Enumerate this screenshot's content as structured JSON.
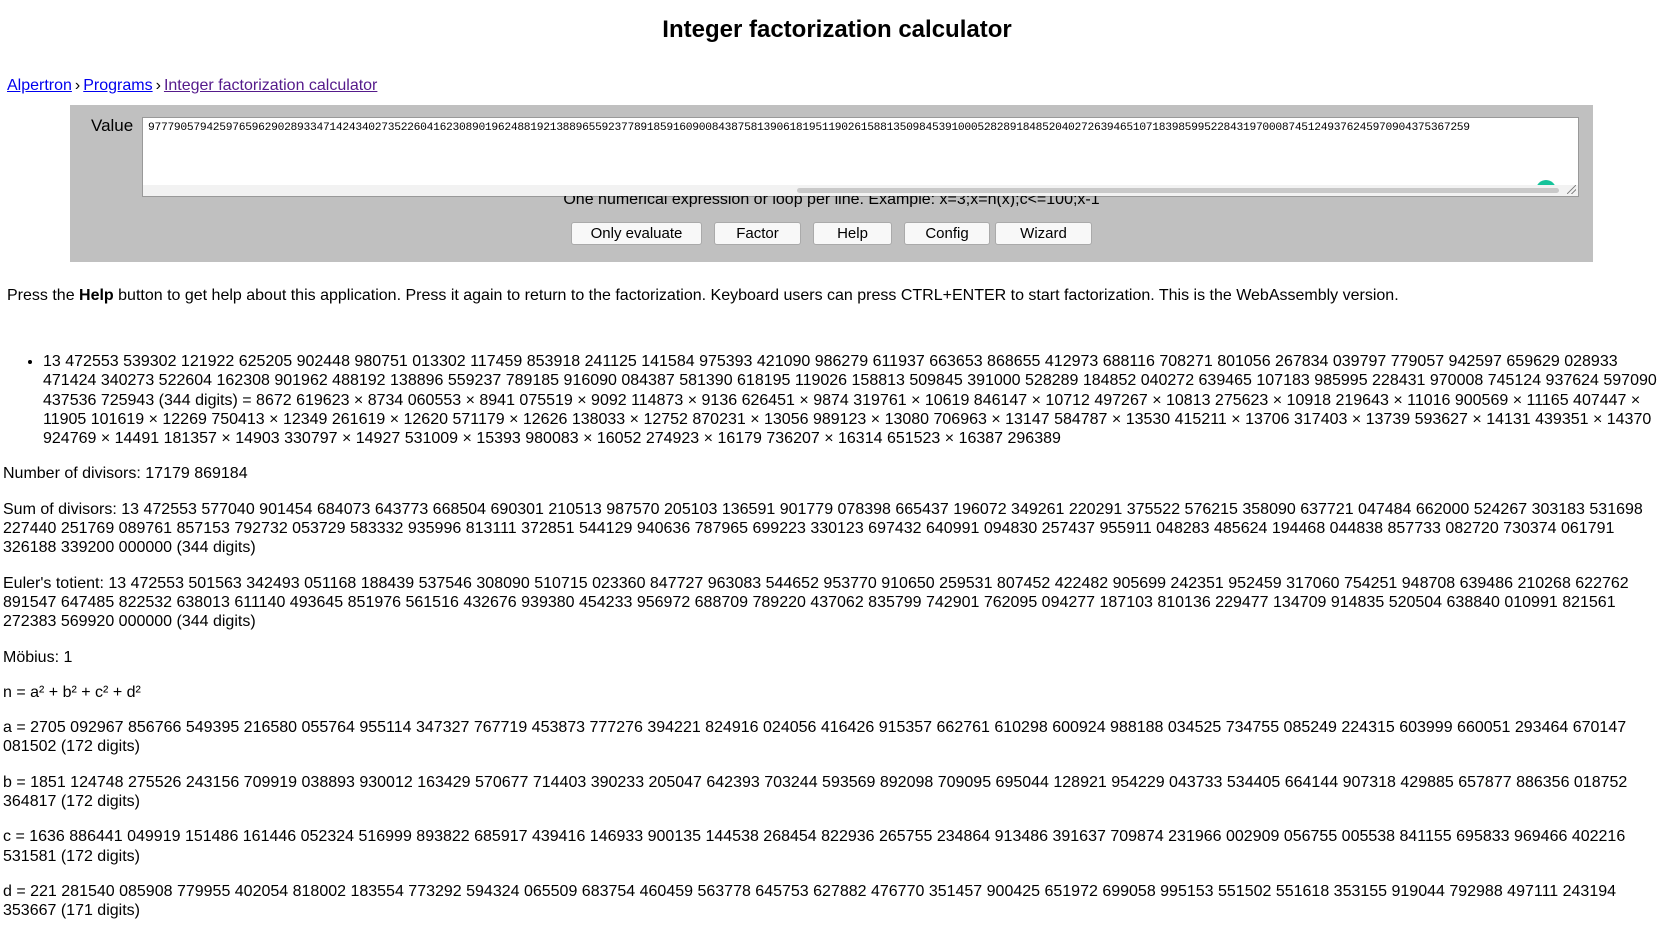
{
  "title": "Integer factorization calculator",
  "breadcrumb": {
    "items": [
      "Alpertron",
      "Programs",
      "Integer factorization calculator"
    ],
    "separator": "›"
  },
  "form": {
    "value_label": "Value",
    "value_text": "977790579425976596290289334714243402735226041623089019624881921388965592377891859160900843875813906181951190261588135098453910005282891848520402726394651071839859952284319700087451249376245970904375367259",
    "hint": "One numerical expression or loop per line. Example: x=3;x=n(x);c<=100;x-1",
    "buttons": {
      "only_evaluate": "Only evaluate",
      "factor": "Factor",
      "help": "Help",
      "config": "Config",
      "wizard": "Wizard"
    }
  },
  "help_line": {
    "pre": "Press the ",
    "bold": "Help",
    "post": " button to get help about this application. Press it again to return to the factorization. Keyboard users can press CTRL+ENTER to start factorization. This is the WebAssembly version."
  },
  "results": {
    "factorization": "13 472553 539302 121922 625205 902448 980751 013302 117459 853918 241125 141584 975393 421090 986279 611937 663653 868655 412973 688116 708271 801056 267834 039797 779057 942597 659629 028933 471424 340273 522604 162308 901962 488192 138896 559237 789185 916090 084387 581390 618195 119026 158813 509845 391000 528289 184852 040272 639465 107183 985995 228431 970008 745124 937624 597090 437536 725943 (344 digits) = 8672 619623 × 8734 060553 × 8941 075519 × 9092 114873 × 9136 626451 × 9874 319761 × 10619 846147 × 10712 497267 × 10813 275623 × 10918 219643 × 11016 900569 × 11165 407447 × 11905 101619 × 12269 750413 × 12349 261619 × 12620 571179 × 12626 138033 × 12752 870231 × 13056 989123 × 13080 706963 × 13147 584787 × 13530 415211 × 13706 317403 × 13739 593627 × 14131 439351 × 14370 924769 × 14491 181357 × 14903 330797 × 14927 531009 × 15393 980083 × 16052 274923 × 16179 736207 × 16314 651523 × 16387 296389",
    "divisors": "Number of divisors: 17179 869184",
    "sum_divisors": "Sum of divisors: 13 472553 577040 901454 684073 643773 668504 690301 210513 987570 205103 136591 901779 078398 665437 196072 349261 220291 375522 576215 358090 637721 047484 662000 524267 303183 531698 227440 251769 089761 857153 792732 053729 583332 935996 813111 372851 544129 940636 787965 699223 330123 697432 640991 094830 257437 955911 048283 485624 194468 044838 857733 082720 730374 061791 326188 339200 000000 (344 digits)",
    "totient": "Euler's totient: 13 472553 501563 342493 051168 188439 537546 308090 510715 023360 847727 963083 544652 953770 910650 259531 807452 422482 905699 242351 952459 317060 754251 948708 639486 210268 622762 891547 647485 822532 638013 611140 493645 851976 561516 432676 939380 454233 956972 688709 789220 437062 835799 742901 762095 094277 187103 810136 229477 134709 914835 520504 638840 010991 821561 272383 569920 000000 (344 digits)",
    "mobius": "Möbius: 1",
    "four_squares": "n = a² + b² + c² + d²",
    "a": "a = 2705 092967 856766 549395 216580 055764 955114 347327 767719 453873 777276 394221 824916 024056 416426 915357 662761 610298 600924 988188 034525 734755 085249 224315 603999 660051 293464 670147 081502 (172 digits)",
    "b": "b = 1851 124748 275526 243156 709919 038893 930012 163429 570677 714403 390233 205047 642393 703244 593569 892098 709095 695044 128921 954229 043733 534405 664144 907318 429885 657877 886356 018752 364817 (172 digits)",
    "c": "c = 1636 886441 049919 151486 161446 052324 516999 893822 685917 439416 146933 900135 144538 268454 822936 265755 234864 913486 391637 709874 231966 002909 056755 005538 841155 695833 969466 402216 531581 (172 digits)",
    "d": "d = 221 281540 085908 779955 402054 818002 183554 773292 594324 065509 683754 460459 563778 645753 627882 476770 351457 900425 651972 699058 995153 551502 551618 353155 919044 792988 497111 243194 353667 (171 digits)"
  },
  "colors": {
    "panel": "#c0c0c0",
    "link": "#0000ee",
    "visited": "#551a8b",
    "grammarly": "#15c39a"
  }
}
